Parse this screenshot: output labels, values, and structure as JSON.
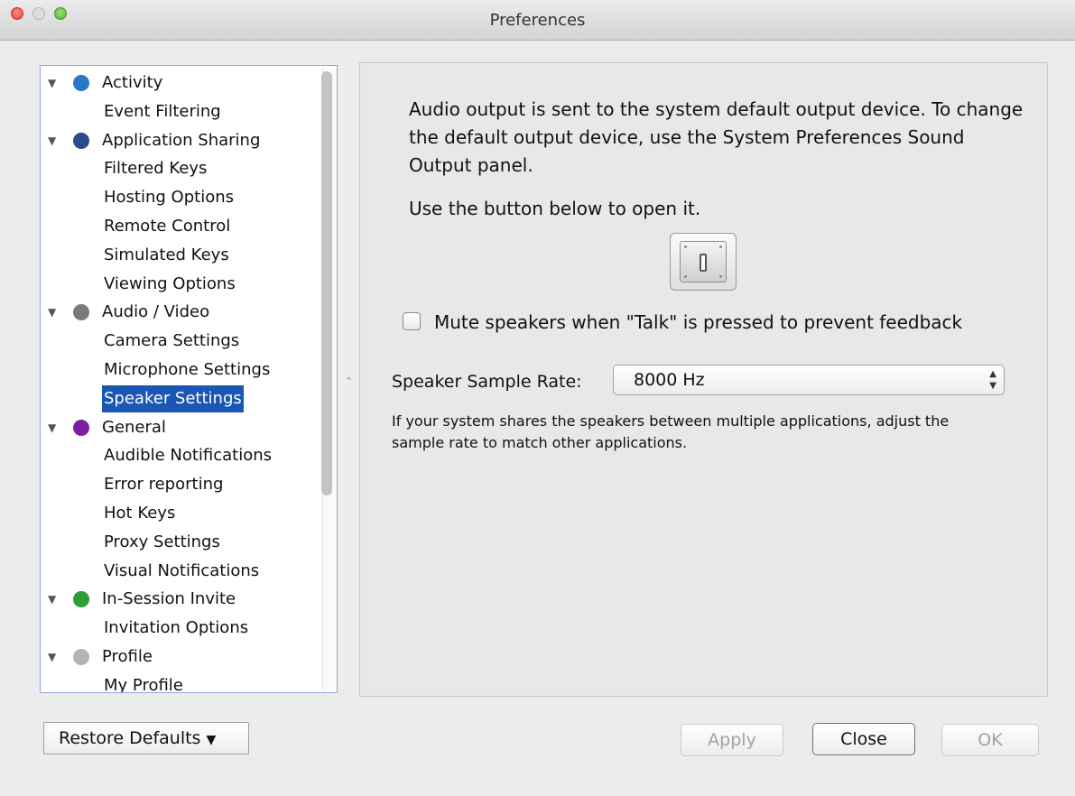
{
  "window": {
    "title": "Preferences"
  },
  "tree": [
    {
      "label": "Activity",
      "icon": "activity-icon",
      "color": "#2b78c6",
      "children": [
        "Event Filtering"
      ]
    },
    {
      "label": "Application Sharing",
      "icon": "monitor-icon",
      "color": "#2f4a8a",
      "children": [
        "Filtered Keys",
        "Hosting Options",
        "Remote Control",
        "Simulated Keys",
        "Viewing Options"
      ]
    },
    {
      "label": "Audio / Video",
      "icon": "webcam-icon",
      "color": "#7a7a7a",
      "children": [
        "Camera Settings",
        "Microphone Settings",
        "Speaker Settings"
      ]
    },
    {
      "label": "General",
      "icon": "general-icon",
      "color": "#7b1fa2",
      "children": [
        "Audible Notifications",
        "Error reporting",
        "Hot Keys",
        "Proxy Settings",
        "Visual Notifications"
      ]
    },
    {
      "label": "In-Session Invite",
      "icon": "invite-icon",
      "color": "#2e9d3a",
      "children": [
        "Invitation Options"
      ]
    },
    {
      "label": "Profile",
      "icon": "profile-icon",
      "color": "#b4b4b4",
      "children": [
        "My Profile"
      ]
    }
  ],
  "selected_item": "Speaker Settings",
  "panel": {
    "info_text": "Audio output is sent to the system default output device. To change the default output device, use the System Preferences  Sound Output panel.",
    "hint_text": "Use the button below to open it.",
    "prefs_button_icon": "system-preferences-icon",
    "mute_label": "Mute speakers when \"Talk\" is pressed to prevent feedback",
    "mute_checked": false,
    "rate_label": "Speaker Sample Rate:",
    "rate_value": "8000 Hz",
    "note_text": "If your system shares the speakers between multiple applications, adjust the sample rate to match other applications."
  },
  "footer": {
    "restore_label": "Restore Defaults",
    "apply_label": "Apply",
    "close_label": "Close",
    "ok_label": "OK"
  }
}
